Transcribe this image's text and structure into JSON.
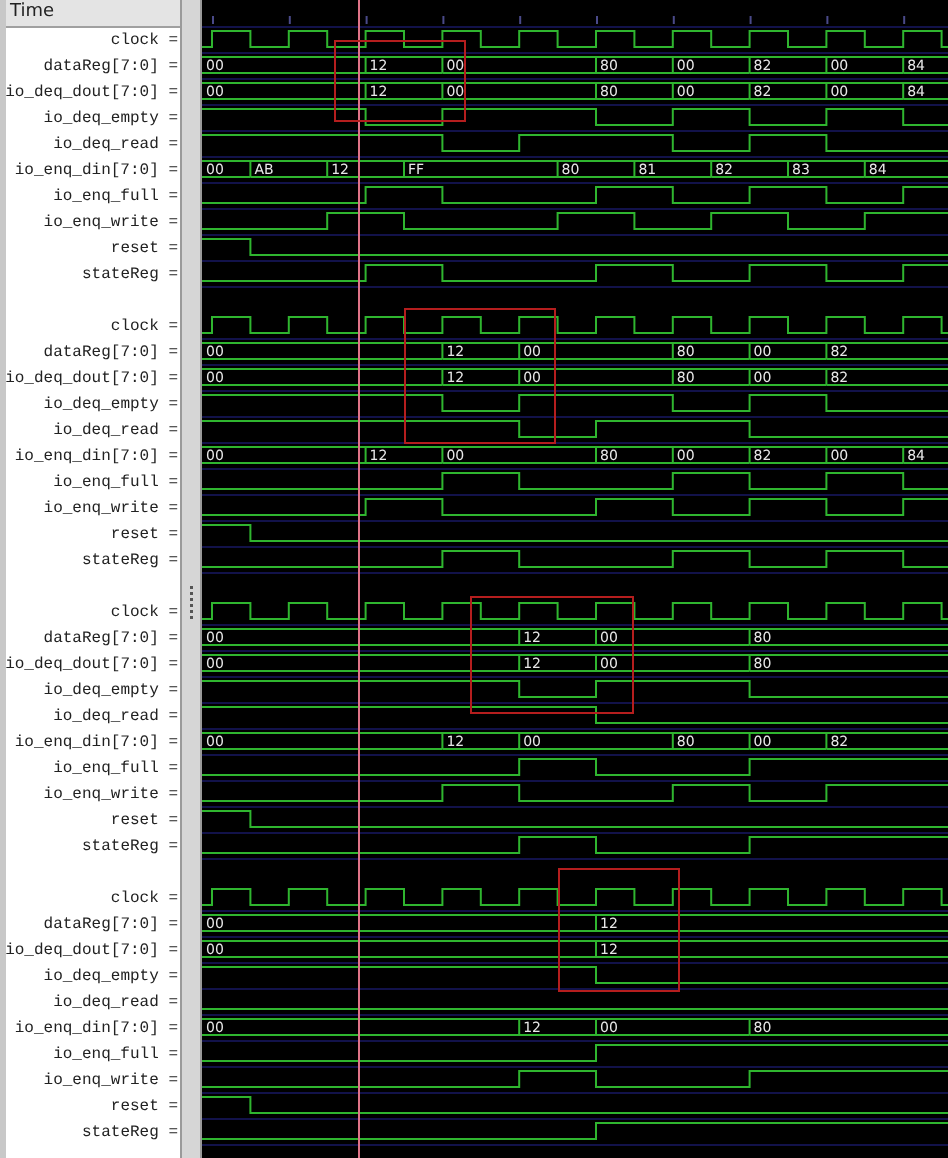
{
  "header": {
    "label": "Time"
  },
  "groups": [
    {
      "signals": [
        {
          "label": "clock =",
          "kind": "clock"
        },
        {
          "label": "dataReg[7:0] =",
          "kind": "bus",
          "values": [
            "00",
            "12",
            "00",
            "80",
            "00",
            "82",
            "00",
            "84"
          ]
        },
        {
          "label": "io_deq_dout[7:0] =",
          "kind": "bus",
          "values": [
            "00",
            "12",
            "00",
            "80",
            "00",
            "82",
            "00",
            "84"
          ]
        },
        {
          "label": "io_deq_empty =",
          "kind": "bit"
        },
        {
          "label": "io_deq_read =",
          "kind": "bit"
        },
        {
          "label": "io_enq_din[7:0] =",
          "kind": "bus",
          "values": [
            "00",
            "AB",
            "12",
            "FF",
            "80",
            "81",
            "82",
            "83",
            "84"
          ]
        },
        {
          "label": "io_enq_full =",
          "kind": "bit"
        },
        {
          "label": "io_enq_write =",
          "kind": "bit"
        },
        {
          "label": "reset =",
          "kind": "bit"
        },
        {
          "label": "stateReg =",
          "kind": "bit"
        }
      ]
    },
    {
      "signals": [
        {
          "label": "clock =",
          "kind": "clock"
        },
        {
          "label": "dataReg[7:0] =",
          "kind": "bus",
          "values": [
            "00",
            "12",
            "00",
            "80",
            "00",
            "82"
          ]
        },
        {
          "label": "io_deq_dout[7:0] =",
          "kind": "bus",
          "values": [
            "00",
            "12",
            "00",
            "80",
            "00",
            "82"
          ]
        },
        {
          "label": "io_deq_empty =",
          "kind": "bit"
        },
        {
          "label": "io_deq_read =",
          "kind": "bit"
        },
        {
          "label": "io_enq_din[7:0] =",
          "kind": "bus",
          "values": [
            "00",
            "12",
            "00",
            "80",
            "00",
            "82",
            "00",
            "84"
          ]
        },
        {
          "label": "io_enq_full =",
          "kind": "bit"
        },
        {
          "label": "io_enq_write =",
          "kind": "bit"
        },
        {
          "label": "reset =",
          "kind": "bit"
        },
        {
          "label": "stateReg =",
          "kind": "bit"
        }
      ]
    },
    {
      "signals": [
        {
          "label": "clock =",
          "kind": "clock"
        },
        {
          "label": "dataReg[7:0] =",
          "kind": "bus",
          "values": [
            "00",
            "12",
            "00",
            "80"
          ]
        },
        {
          "label": "io_deq_dout[7:0] =",
          "kind": "bus",
          "values": [
            "00",
            "12",
            "00",
            "80"
          ]
        },
        {
          "label": "io_deq_empty =",
          "kind": "bit"
        },
        {
          "label": "io_deq_read =",
          "kind": "bit"
        },
        {
          "label": "io_enq_din[7:0] =",
          "kind": "bus",
          "values": [
            "00",
            "12",
            "00",
            "80",
            "00",
            "82"
          ]
        },
        {
          "label": "io_enq_full =",
          "kind": "bit"
        },
        {
          "label": "io_enq_write =",
          "kind": "bit"
        },
        {
          "label": "reset =",
          "kind": "bit"
        },
        {
          "label": "stateReg =",
          "kind": "bit"
        }
      ]
    },
    {
      "signals": [
        {
          "label": "clock =",
          "kind": "clock"
        },
        {
          "label": "dataReg[7:0] =",
          "kind": "bus",
          "values": [
            "00",
            "12"
          ]
        },
        {
          "label": "io_deq_dout[7:0] =",
          "kind": "bus",
          "values": [
            "00",
            "12"
          ]
        },
        {
          "label": "io_deq_empty =",
          "kind": "bit"
        },
        {
          "label": "io_deq_read =",
          "kind": "bit"
        },
        {
          "label": "io_enq_din[7:0] =",
          "kind": "bus",
          "values": [
            "00",
            "12",
            "00",
            "80"
          ]
        },
        {
          "label": "io_enq_full =",
          "kind": "bit"
        },
        {
          "label": "io_enq_write =",
          "kind": "bit"
        },
        {
          "label": "reset =",
          "kind": "bit"
        },
        {
          "label": "stateReg =",
          "kind": "bit"
        }
      ]
    }
  ]
}
